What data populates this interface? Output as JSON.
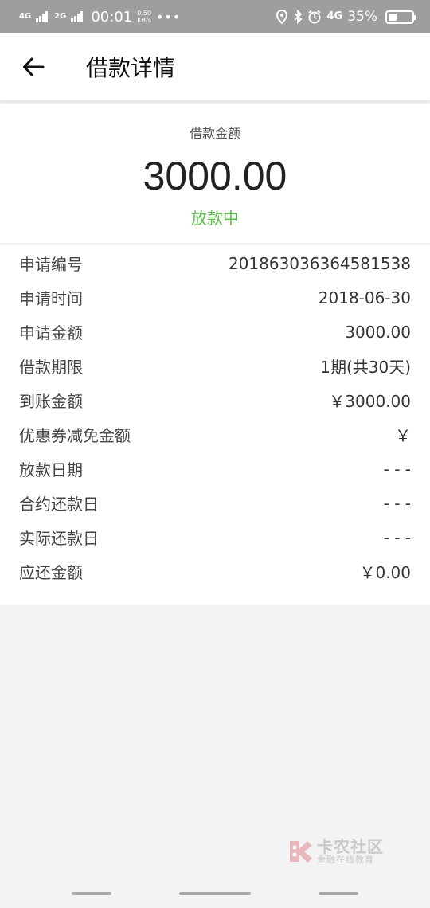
{
  "status_bar": {
    "net1": "4G",
    "net2": "2G",
    "time": "00:01",
    "speed_value": "0.50",
    "speed_unit": "KB/s",
    "more": "•••",
    "net3": "4G",
    "battery_percent": "35%",
    "battery_level": 0.35
  },
  "header": {
    "title": "借款详情"
  },
  "summary": {
    "label": "借款金额",
    "amount": "3000.00",
    "status": "放款中",
    "status_color": "#5cbf4a"
  },
  "details": [
    {
      "label": "申请编号",
      "value": "2018630363645815​38"
    },
    {
      "label": "申请时间",
      "value": "2018-06-30"
    },
    {
      "label": "申请金额",
      "value": "3000.00"
    },
    {
      "label": "借款期限",
      "value": "1期(共30天)"
    },
    {
      "label": "到账金额",
      "value": "￥3000.00"
    },
    {
      "label": "优惠券减免金额",
      "value": "￥"
    },
    {
      "label": "放款日期",
      "value": "- - -"
    },
    {
      "label": "合约还款日",
      "value": "- - -"
    },
    {
      "label": "实际还款日",
      "value": "- - -"
    },
    {
      "label": "应还金额",
      "value": "￥0.00"
    }
  ],
  "watermark": {
    "line1": "卡农社区",
    "line2": "金融在线教育"
  }
}
